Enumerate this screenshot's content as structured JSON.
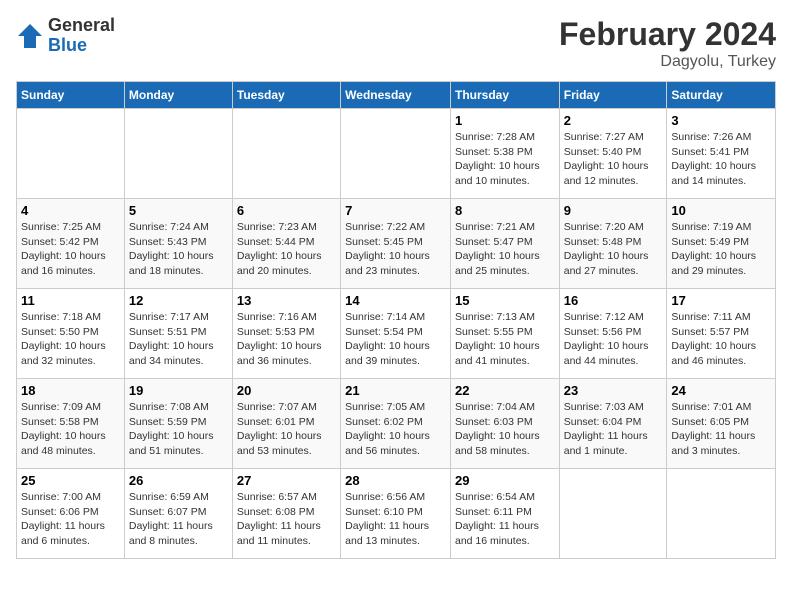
{
  "header": {
    "logo_general": "General",
    "logo_blue": "Blue",
    "month_title": "February 2024",
    "location": "Dagyolu, Turkey"
  },
  "weekdays": [
    "Sunday",
    "Monday",
    "Tuesday",
    "Wednesday",
    "Thursday",
    "Friday",
    "Saturday"
  ],
  "weeks": [
    [
      {
        "day": "",
        "info": ""
      },
      {
        "day": "",
        "info": ""
      },
      {
        "day": "",
        "info": ""
      },
      {
        "day": "",
        "info": ""
      },
      {
        "day": "1",
        "info": "Sunrise: 7:28 AM\nSunset: 5:38 PM\nDaylight: 10 hours\nand 10 minutes."
      },
      {
        "day": "2",
        "info": "Sunrise: 7:27 AM\nSunset: 5:40 PM\nDaylight: 10 hours\nand 12 minutes."
      },
      {
        "day": "3",
        "info": "Sunrise: 7:26 AM\nSunset: 5:41 PM\nDaylight: 10 hours\nand 14 minutes."
      }
    ],
    [
      {
        "day": "4",
        "info": "Sunrise: 7:25 AM\nSunset: 5:42 PM\nDaylight: 10 hours\nand 16 minutes."
      },
      {
        "day": "5",
        "info": "Sunrise: 7:24 AM\nSunset: 5:43 PM\nDaylight: 10 hours\nand 18 minutes."
      },
      {
        "day": "6",
        "info": "Sunrise: 7:23 AM\nSunset: 5:44 PM\nDaylight: 10 hours\nand 20 minutes."
      },
      {
        "day": "7",
        "info": "Sunrise: 7:22 AM\nSunset: 5:45 PM\nDaylight: 10 hours\nand 23 minutes."
      },
      {
        "day": "8",
        "info": "Sunrise: 7:21 AM\nSunset: 5:47 PM\nDaylight: 10 hours\nand 25 minutes."
      },
      {
        "day": "9",
        "info": "Sunrise: 7:20 AM\nSunset: 5:48 PM\nDaylight: 10 hours\nand 27 minutes."
      },
      {
        "day": "10",
        "info": "Sunrise: 7:19 AM\nSunset: 5:49 PM\nDaylight: 10 hours\nand 29 minutes."
      }
    ],
    [
      {
        "day": "11",
        "info": "Sunrise: 7:18 AM\nSunset: 5:50 PM\nDaylight: 10 hours\nand 32 minutes."
      },
      {
        "day": "12",
        "info": "Sunrise: 7:17 AM\nSunset: 5:51 PM\nDaylight: 10 hours\nand 34 minutes."
      },
      {
        "day": "13",
        "info": "Sunrise: 7:16 AM\nSunset: 5:53 PM\nDaylight: 10 hours\nand 36 minutes."
      },
      {
        "day": "14",
        "info": "Sunrise: 7:14 AM\nSunset: 5:54 PM\nDaylight: 10 hours\nand 39 minutes."
      },
      {
        "day": "15",
        "info": "Sunrise: 7:13 AM\nSunset: 5:55 PM\nDaylight: 10 hours\nand 41 minutes."
      },
      {
        "day": "16",
        "info": "Sunrise: 7:12 AM\nSunset: 5:56 PM\nDaylight: 10 hours\nand 44 minutes."
      },
      {
        "day": "17",
        "info": "Sunrise: 7:11 AM\nSunset: 5:57 PM\nDaylight: 10 hours\nand 46 minutes."
      }
    ],
    [
      {
        "day": "18",
        "info": "Sunrise: 7:09 AM\nSunset: 5:58 PM\nDaylight: 10 hours\nand 48 minutes."
      },
      {
        "day": "19",
        "info": "Sunrise: 7:08 AM\nSunset: 5:59 PM\nDaylight: 10 hours\nand 51 minutes."
      },
      {
        "day": "20",
        "info": "Sunrise: 7:07 AM\nSunset: 6:01 PM\nDaylight: 10 hours\nand 53 minutes."
      },
      {
        "day": "21",
        "info": "Sunrise: 7:05 AM\nSunset: 6:02 PM\nDaylight: 10 hours\nand 56 minutes."
      },
      {
        "day": "22",
        "info": "Sunrise: 7:04 AM\nSunset: 6:03 PM\nDaylight: 10 hours\nand 58 minutes."
      },
      {
        "day": "23",
        "info": "Sunrise: 7:03 AM\nSunset: 6:04 PM\nDaylight: 11 hours\nand 1 minute."
      },
      {
        "day": "24",
        "info": "Sunrise: 7:01 AM\nSunset: 6:05 PM\nDaylight: 11 hours\nand 3 minutes."
      }
    ],
    [
      {
        "day": "25",
        "info": "Sunrise: 7:00 AM\nSunset: 6:06 PM\nDaylight: 11 hours\nand 6 minutes."
      },
      {
        "day": "26",
        "info": "Sunrise: 6:59 AM\nSunset: 6:07 PM\nDaylight: 11 hours\nand 8 minutes."
      },
      {
        "day": "27",
        "info": "Sunrise: 6:57 AM\nSunset: 6:08 PM\nDaylight: 11 hours\nand 11 minutes."
      },
      {
        "day": "28",
        "info": "Sunrise: 6:56 AM\nSunset: 6:10 PM\nDaylight: 11 hours\nand 13 minutes."
      },
      {
        "day": "29",
        "info": "Sunrise: 6:54 AM\nSunset: 6:11 PM\nDaylight: 11 hours\nand 16 minutes."
      },
      {
        "day": "",
        "info": ""
      },
      {
        "day": "",
        "info": ""
      }
    ]
  ]
}
